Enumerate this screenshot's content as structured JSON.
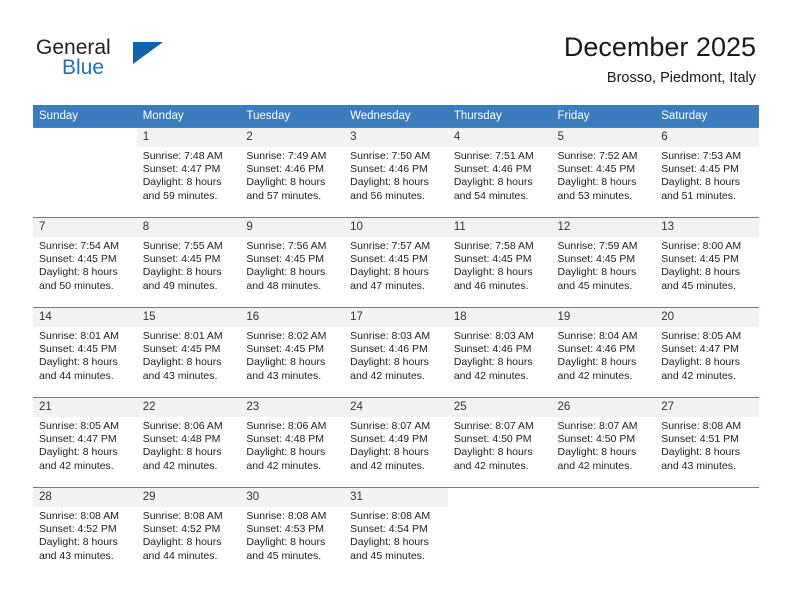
{
  "brand": {
    "word1": "General",
    "word2": "Blue",
    "logo_icon": "triangle-logo-icon",
    "accent_color": "#1263ab"
  },
  "header": {
    "title": "December 2025",
    "subtitle": "Brosso, Piedmont, Italy"
  },
  "theme": {
    "header_bg": "#3a7cbe",
    "daynum_bg": "#f2f2f2",
    "grid_line": "#4a86c4"
  },
  "weekdays": [
    "Sunday",
    "Monday",
    "Tuesday",
    "Wednesday",
    "Thursday",
    "Friday",
    "Saturday"
  ],
  "weeks": [
    [
      {
        "day": "",
        "sunrise": "",
        "sunset": "",
        "daylight1": "",
        "daylight2": ""
      },
      {
        "day": "1",
        "sunrise": "Sunrise: 7:48 AM",
        "sunset": "Sunset: 4:47 PM",
        "daylight1": "Daylight: 8 hours",
        "daylight2": "and 59 minutes."
      },
      {
        "day": "2",
        "sunrise": "Sunrise: 7:49 AM",
        "sunset": "Sunset: 4:46 PM",
        "daylight1": "Daylight: 8 hours",
        "daylight2": "and 57 minutes."
      },
      {
        "day": "3",
        "sunrise": "Sunrise: 7:50 AM",
        "sunset": "Sunset: 4:46 PM",
        "daylight1": "Daylight: 8 hours",
        "daylight2": "and 56 minutes."
      },
      {
        "day": "4",
        "sunrise": "Sunrise: 7:51 AM",
        "sunset": "Sunset: 4:46 PM",
        "daylight1": "Daylight: 8 hours",
        "daylight2": "and 54 minutes."
      },
      {
        "day": "5",
        "sunrise": "Sunrise: 7:52 AM",
        "sunset": "Sunset: 4:45 PM",
        "daylight1": "Daylight: 8 hours",
        "daylight2": "and 53 minutes."
      },
      {
        "day": "6",
        "sunrise": "Sunrise: 7:53 AM",
        "sunset": "Sunset: 4:45 PM",
        "daylight1": "Daylight: 8 hours",
        "daylight2": "and 51 minutes."
      }
    ],
    [
      {
        "day": "7",
        "sunrise": "Sunrise: 7:54 AM",
        "sunset": "Sunset: 4:45 PM",
        "daylight1": "Daylight: 8 hours",
        "daylight2": "and 50 minutes."
      },
      {
        "day": "8",
        "sunrise": "Sunrise: 7:55 AM",
        "sunset": "Sunset: 4:45 PM",
        "daylight1": "Daylight: 8 hours",
        "daylight2": "and 49 minutes."
      },
      {
        "day": "9",
        "sunrise": "Sunrise: 7:56 AM",
        "sunset": "Sunset: 4:45 PM",
        "daylight1": "Daylight: 8 hours",
        "daylight2": "and 48 minutes."
      },
      {
        "day": "10",
        "sunrise": "Sunrise: 7:57 AM",
        "sunset": "Sunset: 4:45 PM",
        "daylight1": "Daylight: 8 hours",
        "daylight2": "and 47 minutes."
      },
      {
        "day": "11",
        "sunrise": "Sunrise: 7:58 AM",
        "sunset": "Sunset: 4:45 PM",
        "daylight1": "Daylight: 8 hours",
        "daylight2": "and 46 minutes."
      },
      {
        "day": "12",
        "sunrise": "Sunrise: 7:59 AM",
        "sunset": "Sunset: 4:45 PM",
        "daylight1": "Daylight: 8 hours",
        "daylight2": "and 45 minutes."
      },
      {
        "day": "13",
        "sunrise": "Sunrise: 8:00 AM",
        "sunset": "Sunset: 4:45 PM",
        "daylight1": "Daylight: 8 hours",
        "daylight2": "and 45 minutes."
      }
    ],
    [
      {
        "day": "14",
        "sunrise": "Sunrise: 8:01 AM",
        "sunset": "Sunset: 4:45 PM",
        "daylight1": "Daylight: 8 hours",
        "daylight2": "and 44 minutes."
      },
      {
        "day": "15",
        "sunrise": "Sunrise: 8:01 AM",
        "sunset": "Sunset: 4:45 PM",
        "daylight1": "Daylight: 8 hours",
        "daylight2": "and 43 minutes."
      },
      {
        "day": "16",
        "sunrise": "Sunrise: 8:02 AM",
        "sunset": "Sunset: 4:45 PM",
        "daylight1": "Daylight: 8 hours",
        "daylight2": "and 43 minutes."
      },
      {
        "day": "17",
        "sunrise": "Sunrise: 8:03 AM",
        "sunset": "Sunset: 4:46 PM",
        "daylight1": "Daylight: 8 hours",
        "daylight2": "and 42 minutes."
      },
      {
        "day": "18",
        "sunrise": "Sunrise: 8:03 AM",
        "sunset": "Sunset: 4:46 PM",
        "daylight1": "Daylight: 8 hours",
        "daylight2": "and 42 minutes."
      },
      {
        "day": "19",
        "sunrise": "Sunrise: 8:04 AM",
        "sunset": "Sunset: 4:46 PM",
        "daylight1": "Daylight: 8 hours",
        "daylight2": "and 42 minutes."
      },
      {
        "day": "20",
        "sunrise": "Sunrise: 8:05 AM",
        "sunset": "Sunset: 4:47 PM",
        "daylight1": "Daylight: 8 hours",
        "daylight2": "and 42 minutes."
      }
    ],
    [
      {
        "day": "21",
        "sunrise": "Sunrise: 8:05 AM",
        "sunset": "Sunset: 4:47 PM",
        "daylight1": "Daylight: 8 hours",
        "daylight2": "and 42 minutes."
      },
      {
        "day": "22",
        "sunrise": "Sunrise: 8:06 AM",
        "sunset": "Sunset: 4:48 PM",
        "daylight1": "Daylight: 8 hours",
        "daylight2": "and 42 minutes."
      },
      {
        "day": "23",
        "sunrise": "Sunrise: 8:06 AM",
        "sunset": "Sunset: 4:48 PM",
        "daylight1": "Daylight: 8 hours",
        "daylight2": "and 42 minutes."
      },
      {
        "day": "24",
        "sunrise": "Sunrise: 8:07 AM",
        "sunset": "Sunset: 4:49 PM",
        "daylight1": "Daylight: 8 hours",
        "daylight2": "and 42 minutes."
      },
      {
        "day": "25",
        "sunrise": "Sunrise: 8:07 AM",
        "sunset": "Sunset: 4:50 PM",
        "daylight1": "Daylight: 8 hours",
        "daylight2": "and 42 minutes."
      },
      {
        "day": "26",
        "sunrise": "Sunrise: 8:07 AM",
        "sunset": "Sunset: 4:50 PM",
        "daylight1": "Daylight: 8 hours",
        "daylight2": "and 42 minutes."
      },
      {
        "day": "27",
        "sunrise": "Sunrise: 8:08 AM",
        "sunset": "Sunset: 4:51 PM",
        "daylight1": "Daylight: 8 hours",
        "daylight2": "and 43 minutes."
      }
    ],
    [
      {
        "day": "28",
        "sunrise": "Sunrise: 8:08 AM",
        "sunset": "Sunset: 4:52 PM",
        "daylight1": "Daylight: 8 hours",
        "daylight2": "and 43 minutes."
      },
      {
        "day": "29",
        "sunrise": "Sunrise: 8:08 AM",
        "sunset": "Sunset: 4:52 PM",
        "daylight1": "Daylight: 8 hours",
        "daylight2": "and 44 minutes."
      },
      {
        "day": "30",
        "sunrise": "Sunrise: 8:08 AM",
        "sunset": "Sunset: 4:53 PM",
        "daylight1": "Daylight: 8 hours",
        "daylight2": "and 45 minutes."
      },
      {
        "day": "31",
        "sunrise": "Sunrise: 8:08 AM",
        "sunset": "Sunset: 4:54 PM",
        "daylight1": "Daylight: 8 hours",
        "daylight2": "and 45 minutes."
      },
      {
        "day": "",
        "sunrise": "",
        "sunset": "",
        "daylight1": "",
        "daylight2": ""
      },
      {
        "day": "",
        "sunrise": "",
        "sunset": "",
        "daylight1": "",
        "daylight2": ""
      },
      {
        "day": "",
        "sunrise": "",
        "sunset": "",
        "daylight1": "",
        "daylight2": ""
      }
    ]
  ]
}
